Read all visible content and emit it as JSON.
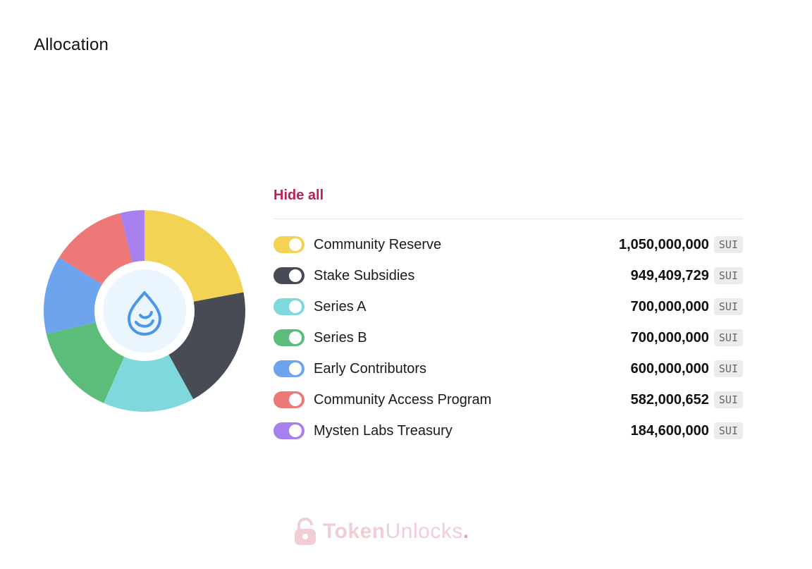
{
  "page": {
    "title": "Allocation"
  },
  "legend": {
    "hide_all_label": "Hide all"
  },
  "watermark": {
    "text_bold": "Token",
    "text_light": "Unlocks",
    "dot": "."
  },
  "chart_data": {
    "type": "pie",
    "donut": true,
    "center_icon": "sui-drop-icon",
    "unit": "SUI",
    "categories": [
      "Community Reserve",
      "Stake Subsidies",
      "Series A",
      "Series B",
      "Early Contributors",
      "Community Access Program",
      "Mysten Labs Treasury"
    ],
    "values": [
      1050000000,
      949409729,
      700000000,
      700000000,
      600000000,
      582000652,
      184600000
    ],
    "value_labels": [
      "1,050,000,000",
      "949,409,729",
      "700,000,000",
      "700,000,000",
      "600,000,000",
      "582,000,652",
      "184,600,000"
    ],
    "colors": [
      "#f2d354",
      "#474b53",
      "#7fd8dc",
      "#5bbd79",
      "#6ea3ee",
      "#ee7777",
      "#a580ee"
    ],
    "legend_placement": "right"
  }
}
